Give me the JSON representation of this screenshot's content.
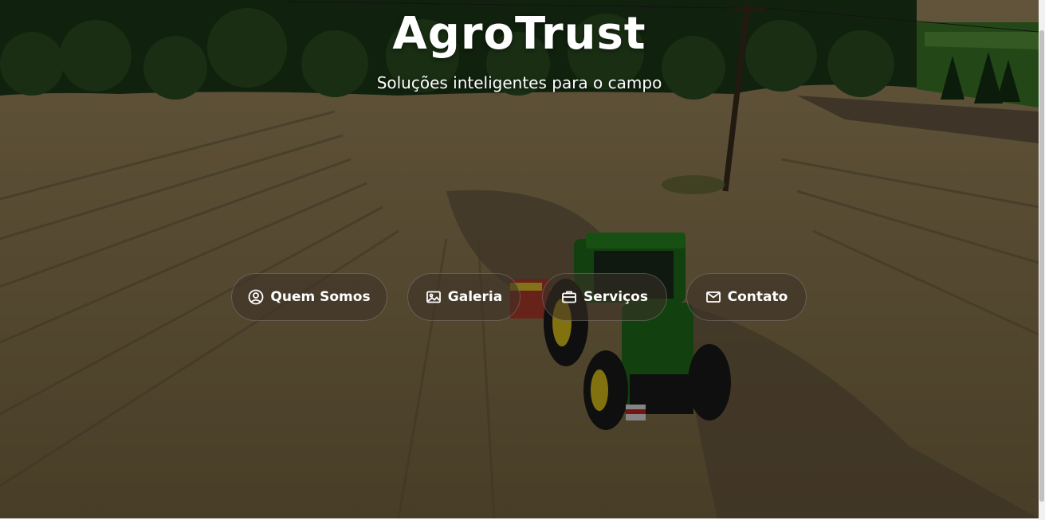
{
  "hero": {
    "title": "AgroTrust",
    "subtitle": "Soluções inteligentes para o campo",
    "background_image": "aerial-field-tractor"
  },
  "nav": {
    "buttons": [
      {
        "label": "Quem Somos",
        "icon": "user-circle-icon"
      },
      {
        "label": "Galeria",
        "icon": "image-icon"
      },
      {
        "label": "Serviços",
        "icon": "briefcase-icon"
      },
      {
        "label": "Contato",
        "icon": "envelope-icon"
      }
    ]
  },
  "colors": {
    "text": "#ffffff",
    "button_bg": "rgba(60,50,40,0.55)",
    "field": "#8a7648",
    "tractor_green": "#1f6e1a",
    "wheel_yellow": "#e1c51b"
  }
}
